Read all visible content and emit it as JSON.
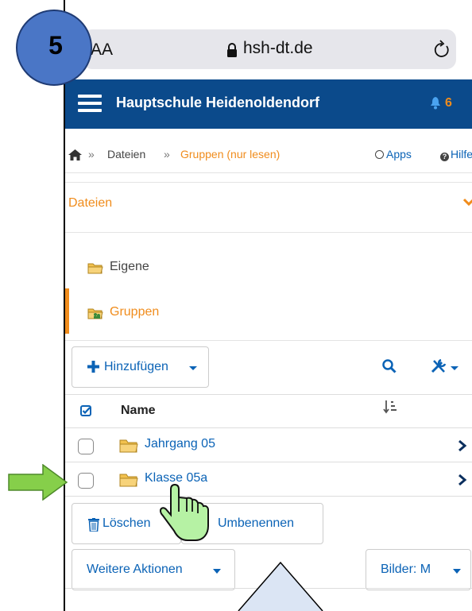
{
  "step": {
    "number": "5"
  },
  "browser": {
    "text_size_label": "AA",
    "domain": "hsh-dt.de"
  },
  "appbar": {
    "title": "Hauptschule Heidenoldendorf",
    "notification_count": "6",
    "colors": {
      "header_bg": "#0b4a8b",
      "accent": "#f08c1c",
      "link": "#0b63b6"
    }
  },
  "breadcrumb": {
    "separator": "»",
    "items": [
      "Dateien",
      "Gruppen (nur lesen)"
    ],
    "apps_label": "Apps",
    "help_label": "Hilfe"
  },
  "panel": {
    "title": "Dateien",
    "nav": [
      {
        "label": "Eigene",
        "icon": "folder-icon"
      },
      {
        "label": "Gruppen",
        "icon": "group-folder-icon",
        "active": true
      }
    ]
  },
  "toolbar": {
    "add_label": "Hinzufügen",
    "search_icon": "search-icon",
    "tools_icon": "tools-icon"
  },
  "table": {
    "column_name": "Name",
    "rows": [
      {
        "label": "Jahrgang 05",
        "icon": "folder-icon"
      },
      {
        "label": "Klasse 05a",
        "icon": "folder-icon"
      }
    ]
  },
  "actions": {
    "delete_label": "Löschen",
    "rename_label": "Umbenennen",
    "more_label": "Weitere Aktionen",
    "images_label": "Bilder: M"
  }
}
